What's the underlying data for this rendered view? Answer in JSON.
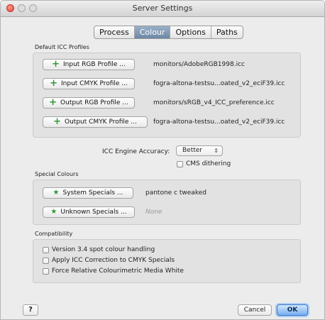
{
  "window": {
    "title": "Server Settings"
  },
  "tabs": [
    {
      "label": "Process",
      "active": false
    },
    {
      "label": "Colour",
      "active": true
    },
    {
      "label": "Options",
      "active": false
    },
    {
      "label": "Paths",
      "active": false
    }
  ],
  "icc": {
    "section_label": "Default ICC Profiles",
    "rows": [
      {
        "button": "Input RGB Profile ...",
        "value": "monitors/AdobeRGB1998.icc"
      },
      {
        "button": "Input CMYK Profile ...",
        "value": "fogra-altona-testsu...oated_v2_eciF39.icc"
      },
      {
        "button": "Output RGB Profile ...",
        "value": "monitors/sRGB_v4_ICC_preference.icc"
      },
      {
        "button": "Output CMYK Profile ...",
        "value": "fogra-altona-testsu...oated_v2_eciF39.icc"
      }
    ]
  },
  "engine": {
    "label": "ICC Engine Accuracy:",
    "selected": "Better",
    "arrows": "⇕",
    "cms_dithering": {
      "label": "CMS dithering",
      "checked": false
    }
  },
  "special": {
    "section_label": "Special Colours",
    "rows": [
      {
        "button": "System Specials ...",
        "value": "pantone c tweaked",
        "none": false
      },
      {
        "button": "Unknown Specials ...",
        "value": "None",
        "none": true
      }
    ]
  },
  "compat": {
    "section_label": "Compatibility",
    "options": [
      {
        "label": "Version 3.4 spot colour handling",
        "checked": false
      },
      {
        "label": "Apply ICC Correction to CMYK Specials",
        "checked": false
      },
      {
        "label": "Force Relative Colourimetric Media White",
        "checked": false
      }
    ]
  },
  "footer": {
    "help_label": "?",
    "cancel_label": "Cancel",
    "ok_label": "OK"
  },
  "icons": {
    "plus": "+",
    "star": "★"
  },
  "colors": {
    "accent_green": "#2d9a32",
    "ok_blue": "#76aef0",
    "active_tab": "#6c87a6"
  }
}
